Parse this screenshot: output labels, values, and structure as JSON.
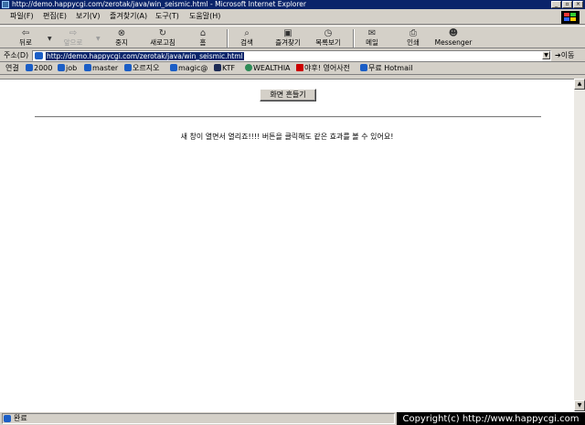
{
  "window": {
    "title": "http://demo.happycgi.com/zerotak/java/win_seismic.html - Microsoft Internet Explorer",
    "buttons": [
      "_",
      "▫",
      "×"
    ]
  },
  "menu": [
    "파일(F)",
    "편집(E)",
    "보기(V)",
    "즐겨찾기(A)",
    "도구(T)",
    "도움말(H)"
  ],
  "toolbar": {
    "back": "뒤로",
    "forward": "앞으로",
    "stop": "중지",
    "refresh": "새로고침",
    "home": "홈",
    "search": "검색",
    "favorites": "즐겨찾기",
    "history": "목록보기",
    "mail": "메일",
    "print": "인쇄",
    "messenger": "Messenger"
  },
  "address": {
    "label": "주소(D)",
    "url": "http://demo.happycgi.com/zerotak/java/win_seismic.html",
    "go": "이동"
  },
  "links": {
    "label": "연결",
    "items": [
      "2000",
      "job",
      "master",
      "오르지오",
      "magic@",
      "KTF",
      "WEALTHIA",
      "야후! 영어사전",
      "무료 Hotmail"
    ]
  },
  "page": {
    "shake_button": "화면 흔들기",
    "message": "새 창이 열면서 열리죠!!!! 버튼을 클릭해도 같은 효과를 볼 수 있어요!"
  },
  "status": {
    "text": "완료",
    "copyright": "Copyright(c) http://www.happycgi.com"
  },
  "colors": {
    "titlebar": "#0a246a",
    "chrome": "#d4d0c8",
    "content_bg": "#ffffff"
  }
}
